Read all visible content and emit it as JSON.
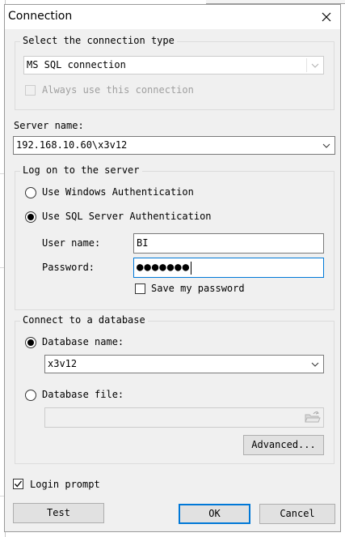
{
  "dialog": {
    "title": "Connection"
  },
  "connection_type": {
    "group_label": "Select the connection type",
    "selected": "MS SQL connection",
    "always_use_label": "Always use this connection",
    "always_use_checked": false
  },
  "server": {
    "label": "Server name:",
    "value": "192.168.10.60\\x3v12"
  },
  "logon": {
    "group_label": "Log on to the server",
    "windows_auth_label": "Use Windows Authentication",
    "sql_auth_label": "Use SQL Server Authentication",
    "selected": "sql",
    "user_label": "User name:",
    "user_value": "BI",
    "password_label": "Password:",
    "password_mask": "●●●●●●●",
    "save_password_label": "Save my password",
    "save_password_checked": false
  },
  "database": {
    "group_label": "Connect to a database",
    "db_name_label": "Database name:",
    "db_name_value": "x3v12",
    "db_file_label": "Database file:",
    "db_file_value": "",
    "selected": "name",
    "advanced_label": "Advanced..."
  },
  "footer": {
    "login_prompt_label": "Login prompt",
    "login_prompt_checked": true,
    "test_label": "Test",
    "ok_label": "OK",
    "cancel_label": "Cancel"
  },
  "icons": {
    "close": "close-icon",
    "dropdown": "chevron-down-icon",
    "browse": "folder-open-icon",
    "check": "checkmark-icon"
  }
}
